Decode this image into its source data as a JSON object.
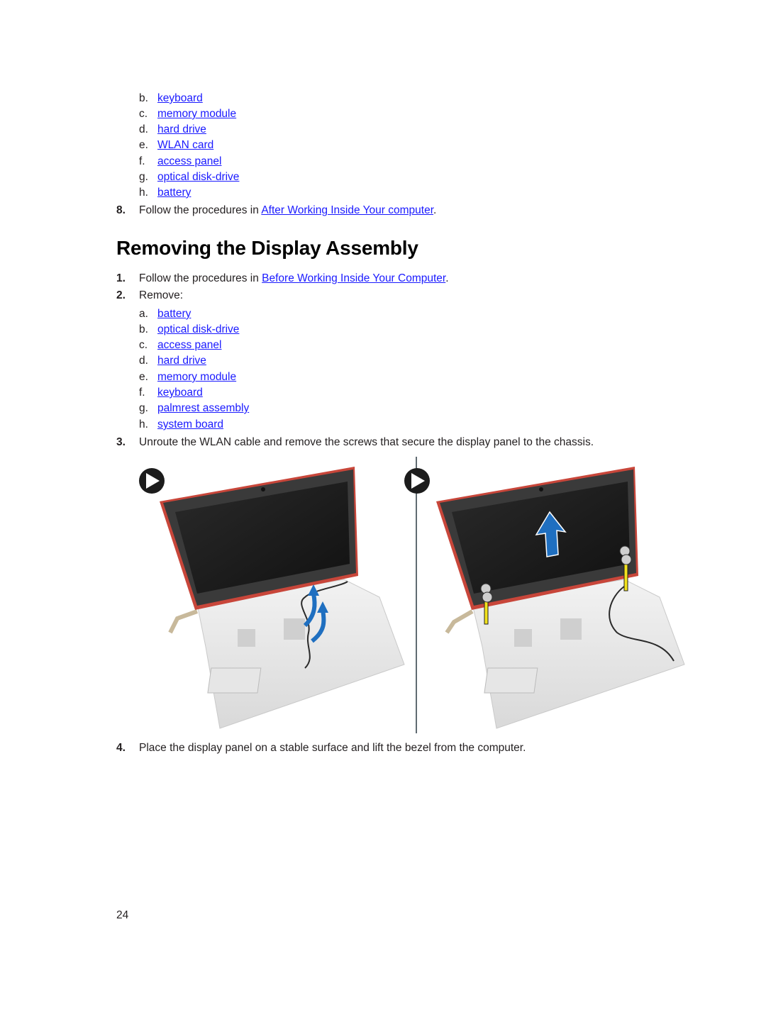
{
  "continued_list": {
    "items": [
      {
        "letter": "b.",
        "label": "keyboard"
      },
      {
        "letter": "c.",
        "label": "memory module"
      },
      {
        "letter": "d.",
        "label": "hard drive"
      },
      {
        "letter": "e.",
        "label": "WLAN card"
      },
      {
        "letter": "f.",
        "label": "access panel"
      },
      {
        "letter": "g.",
        "label": "optical disk-drive"
      },
      {
        "letter": "h.",
        "label": "battery"
      }
    ],
    "step8": {
      "number": "8.",
      "prefix": "Follow the procedures in ",
      "link": "After Working Inside Your computer",
      "suffix": "."
    }
  },
  "section": {
    "title": "Removing the Display Assembly",
    "step1": {
      "number": "1.",
      "prefix": "Follow the procedures in ",
      "link": "Before Working Inside Your Computer",
      "suffix": "."
    },
    "step2": {
      "number": "2.",
      "text": "Remove:",
      "items": [
        {
          "letter": "a.",
          "label": "battery"
        },
        {
          "letter": "b.",
          "label": "optical disk-drive"
        },
        {
          "letter": "c.",
          "label": "access panel"
        },
        {
          "letter": "d.",
          "label": "hard drive"
        },
        {
          "letter": "e.",
          "label": "memory module"
        },
        {
          "letter": "f.",
          "label": "keyboard"
        },
        {
          "letter": "g.",
          "label": "palmrest assembly"
        },
        {
          "letter": "h.",
          "label": "system board"
        }
      ]
    },
    "step3": {
      "number": "3.",
      "text": "Unroute the WLAN cable and remove the screws that secure the display panel to the chassis."
    },
    "step4": {
      "number": "4.",
      "text": "Place the display panel on a stable surface and lift the bezel from the computer."
    }
  },
  "figure": {
    "panels": [
      {
        "icon": "play-icon",
        "description": "laptop with WLAN cable being unrouted (blue curved arrows)"
      },
      {
        "icon": "play-icon",
        "description": "laptop with hinge screws highlighted and blue up arrow"
      }
    ],
    "colors": {
      "arrow": "#1f6fc0",
      "bezel": "#c8463a",
      "screen": "#1c1c1c",
      "screw_guide": "#f2e21c"
    }
  },
  "page_number": "24"
}
